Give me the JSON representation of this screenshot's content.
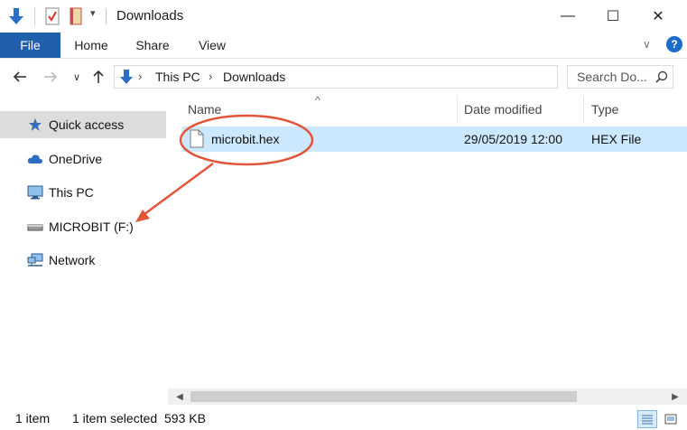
{
  "window": {
    "title": "Downloads",
    "controls": {
      "minimize": "—",
      "maximize": "☐",
      "close": "✕"
    }
  },
  "ribbon": {
    "tabs": [
      {
        "label": "File",
        "active": true
      },
      {
        "label": "Home"
      },
      {
        "label": "Share"
      },
      {
        "label": "View"
      }
    ],
    "help_label": "?"
  },
  "address": {
    "segments": [
      "This PC",
      "Downloads"
    ],
    "search_placeholder": "Search Do..."
  },
  "nav": {
    "items": [
      {
        "label": "Quick access",
        "icon": "star-icon",
        "selected": true
      },
      {
        "label": "OneDrive",
        "icon": "cloud-icon"
      },
      {
        "label": "This PC",
        "icon": "monitor-icon"
      },
      {
        "label": "MICROBIT (F:)",
        "icon": "drive-icon"
      },
      {
        "label": "Network",
        "icon": "network-icon"
      }
    ]
  },
  "list": {
    "columns": [
      "Name",
      "Date modified",
      "Type"
    ],
    "rows": [
      {
        "name": "microbit.hex",
        "date": "29/05/2019 12:00",
        "type": "HEX File",
        "selected": true
      }
    ]
  },
  "status": {
    "count": "1 item",
    "selection": "1 item selected",
    "size": "593 KB"
  },
  "colors": {
    "file_tab": "#1f5fab",
    "selection": "#cce8ff",
    "annotation": "#e2553a",
    "nav_selected": "#dcdcdc"
  }
}
